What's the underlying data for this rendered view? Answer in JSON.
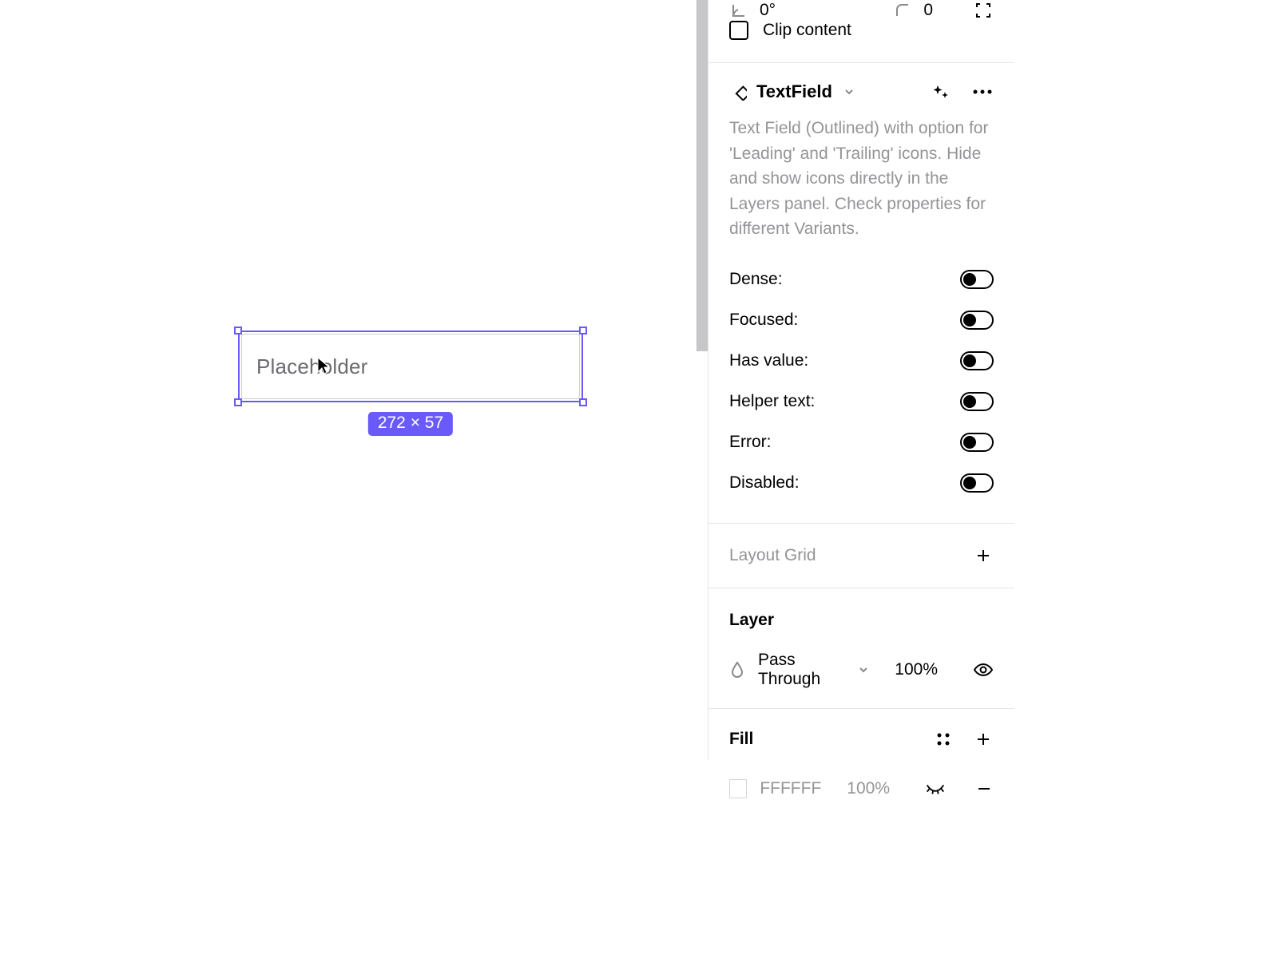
{
  "canvas": {
    "placeholder": "Placeholder",
    "dimensions": "272 × 57"
  },
  "transform": {
    "rotation": "0°",
    "corner_radius": "0",
    "clip_content_label": "Clip content"
  },
  "component": {
    "name": "TextField",
    "description": "Text Field (Outlined) with option for 'Leading' and 'Trailing' icons. Hide and show icons directly in the Layers panel. Check properties for different Variants.",
    "variants": [
      {
        "label": "Dense:"
      },
      {
        "label": "Focused:"
      },
      {
        "label": "Has value:"
      },
      {
        "label": "Helper text:"
      },
      {
        "label": "Error:"
      },
      {
        "label": "Disabled:"
      }
    ]
  },
  "layout_grid": {
    "title": "Layout Grid"
  },
  "layer": {
    "title": "Layer",
    "blend_mode": "Pass Through",
    "opacity": "100%"
  },
  "fill": {
    "title": "Fill",
    "hex": "FFFFFF",
    "opacity": "100%"
  }
}
